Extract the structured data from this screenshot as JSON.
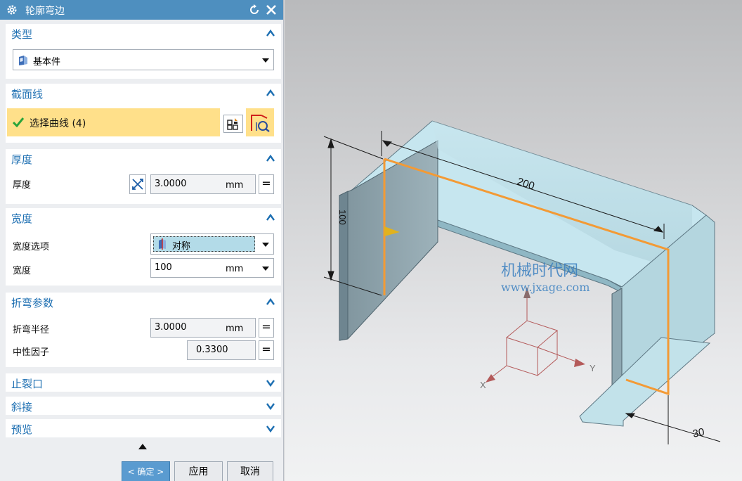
{
  "dialog": {
    "title": "轮廓弯边",
    "type_section": {
      "title": "类型",
      "selected": "基本件"
    },
    "section_line": {
      "title": "截面线",
      "selection": "选择曲线 (4)"
    },
    "thickness": {
      "title": "厚度",
      "label": "厚度",
      "value": "3.0000",
      "unit": "mm",
      "eq": "="
    },
    "width": {
      "title": "宽度",
      "option_label": "宽度选项",
      "option_value": "对称",
      "width_label": "宽度",
      "width_value": "100",
      "width_unit": "mm"
    },
    "bend": {
      "title": "折弯参数",
      "radius_label": "折弯半径",
      "radius_value": "3.0000",
      "radius_unit": "mm",
      "radius_eq": "=",
      "neutral_label": "中性因子",
      "neutral_value": "0.3300",
      "neutral_eq": "="
    },
    "relief": {
      "title": "止裂口"
    },
    "miter": {
      "title": "斜接"
    },
    "preview": {
      "title": "预览"
    },
    "buttons": {
      "ok": "< 确定 >",
      "apply": "应用",
      "cancel": "取消"
    }
  },
  "viewport": {
    "dimensions": {
      "length": "200",
      "height": "100",
      "flange": "30"
    },
    "watermark": {
      "line1": "机械时代网",
      "line2": "www.jxage.com"
    },
    "axes": {
      "x": "X",
      "y": "Y"
    }
  },
  "colors": {
    "title_bar": "#4e8fbf",
    "section_title": "#1d6fb2",
    "selection_highlight": "#ffe08a",
    "profile_line": "#f39a35",
    "part_fill": "#b8dce6",
    "watermark": "#3a7fc0"
  },
  "icons": {
    "title": "gear-icon",
    "reset": "reset-icon",
    "close": "close-icon",
    "type": "base-part-icon",
    "check": "check-icon",
    "curve_select": "curve-select-icon",
    "reverse": "reverse-direction-icon",
    "symmetric": "symmetric-icon",
    "swap": "swap-direction-icon"
  }
}
